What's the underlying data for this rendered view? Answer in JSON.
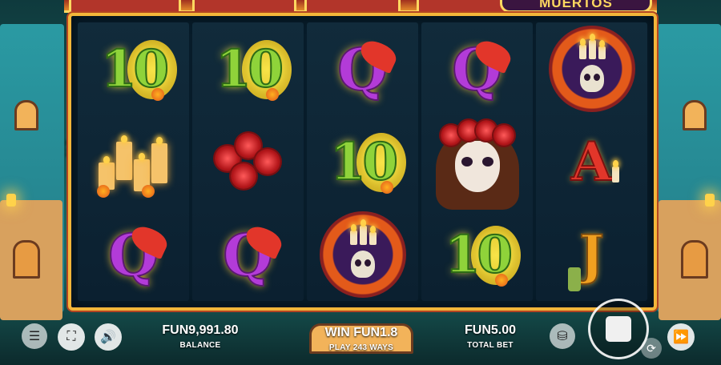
{
  "game": {
    "logo_text": "MUERTOS",
    "ways_badge": "243",
    "reels": [
      [
        "10",
        "candles",
        "Q"
      ],
      [
        "10",
        "roses",
        "Q"
      ],
      [
        "Q",
        "10",
        "wreath"
      ],
      [
        "Q",
        "catrina",
        "10"
      ],
      [
        "wreath",
        "A",
        "J"
      ]
    ]
  },
  "hud": {
    "balance_value": "FUN9,991.80",
    "balance_label": "BALANCE",
    "win_value": "WIN FUN1.8",
    "ways_label": "PLAY 243 WAYS",
    "total_bet_value": "FUN5.00",
    "total_bet_label": "TOTAL BET"
  },
  "icons": {
    "menu": "menu-icon",
    "fullscreen": "fullscreen-icon",
    "sound": "speaker-icon",
    "coins": "coins-icon",
    "spin": "stop-icon",
    "autoplay": "autoplay-icon",
    "turbo": "fast-forward-icon"
  },
  "colors": {
    "frame": "#f3b63a",
    "ten": "#8fd33a",
    "queen": "#b33bd8",
    "ace": "#e2362a",
    "jack": "#f0a020"
  }
}
